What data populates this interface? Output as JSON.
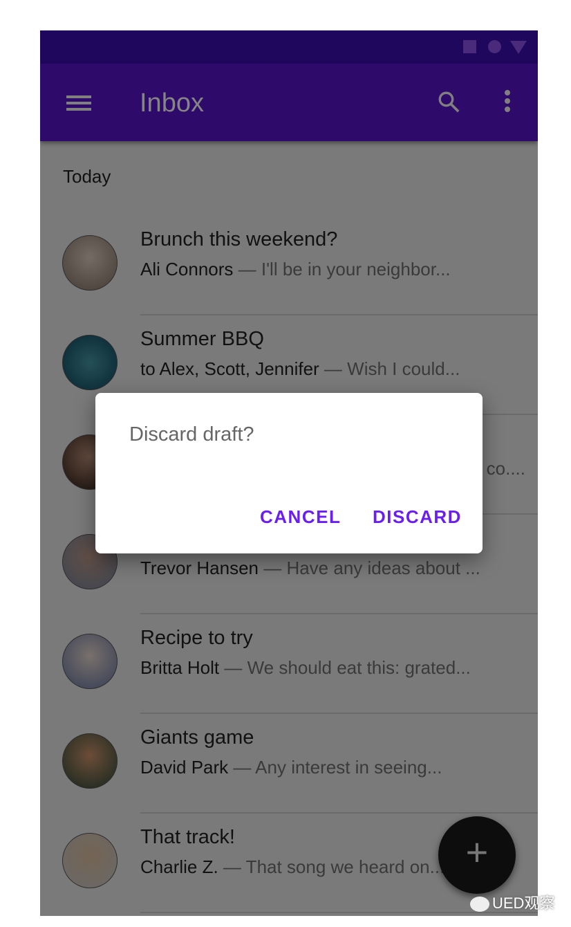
{
  "status_bar": {
    "icons": [
      "square-icon",
      "circle-icon",
      "triangle-icon"
    ]
  },
  "app_bar": {
    "title": "Inbox",
    "menu_icon": "hamburger-menu-icon",
    "search_icon": "search-icon",
    "more_icon": "more-vert-icon"
  },
  "section_label": "Today",
  "messages": [
    {
      "headline": "Brunch this weekend?",
      "sender": "Ali Connors",
      "preview": " — I'll be in your neighbor..."
    },
    {
      "headline": "Summer BBQ",
      "sender": "to Alex, Scott, Jennifer",
      "preview": " — Wish I could..."
    },
    {
      "headline": "",
      "sender": "",
      "preview": "co...."
    },
    {
      "headline": "",
      "sender": "Trevor Hansen",
      "preview": " — Have any ideas about ..."
    },
    {
      "headline": "Recipe to try",
      "sender": "Britta Holt",
      "preview": " — We should eat this: grated..."
    },
    {
      "headline": "Giants game",
      "sender": "David Park",
      "preview": " — Any interest in seeing..."
    },
    {
      "headline": "That track!",
      "sender": "Charlie Z.",
      "preview": " — That song we heard on..."
    }
  ],
  "fab": {
    "icon": "plus-icon",
    "label": "+"
  },
  "dialog": {
    "title": "Discard draft?",
    "cancel": "CANCEL",
    "confirm": "DISCARD",
    "accent": "#6200ee"
  },
  "watermark": "UED观察"
}
